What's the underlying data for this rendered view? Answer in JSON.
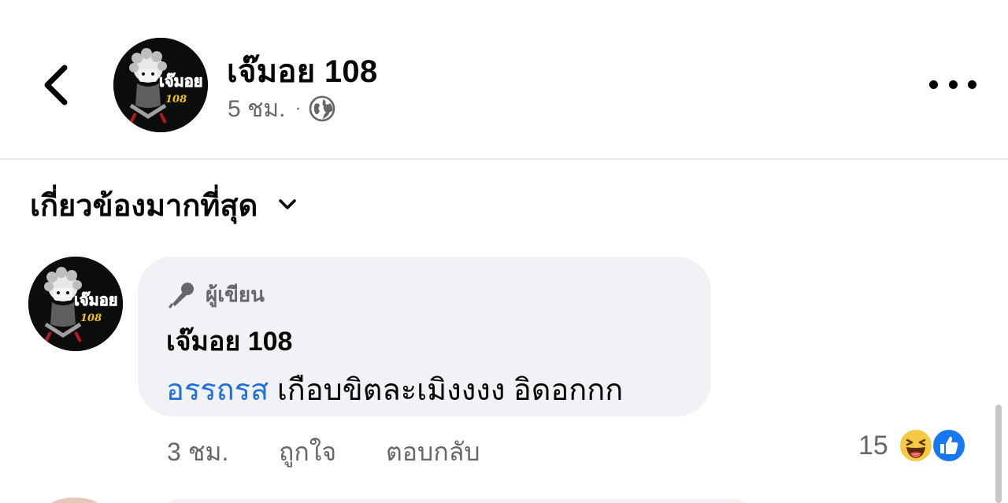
{
  "header": {
    "page_name": "เจ๊มอย 108",
    "post_time": "5 ชม.",
    "separator": "·",
    "privacy_icon": "globe-icon",
    "back_icon": "chevron-left-icon",
    "more_icon": "more-horizontal-icon"
  },
  "avatar": {
    "logo_text": "เจ๊มอย",
    "logo_number": "108"
  },
  "sort": {
    "label": "เกี่ยวข้องมากที่สุด",
    "icon": "chevron-down-icon"
  },
  "comment": {
    "author_badge_label": "ผู้เขียน",
    "author_badge_icon": "microphone-icon",
    "name": "เจ๊มอย 108",
    "mention": "อรรถรส",
    "text": " เกือบขิตละเมิงงงง อิดอกกก",
    "time": "3 ชม.",
    "like_label": "ถูกใจ",
    "reply_label": "ตอบกลับ",
    "reaction_count": "15",
    "reaction_icons": [
      "haha-icon",
      "like-icon"
    ]
  },
  "colors": {
    "accent_link": "#216fdb",
    "like_blue": "#1877f2",
    "bubble_bg": "#f0f2f5",
    "secondary_text": "#65676b"
  }
}
